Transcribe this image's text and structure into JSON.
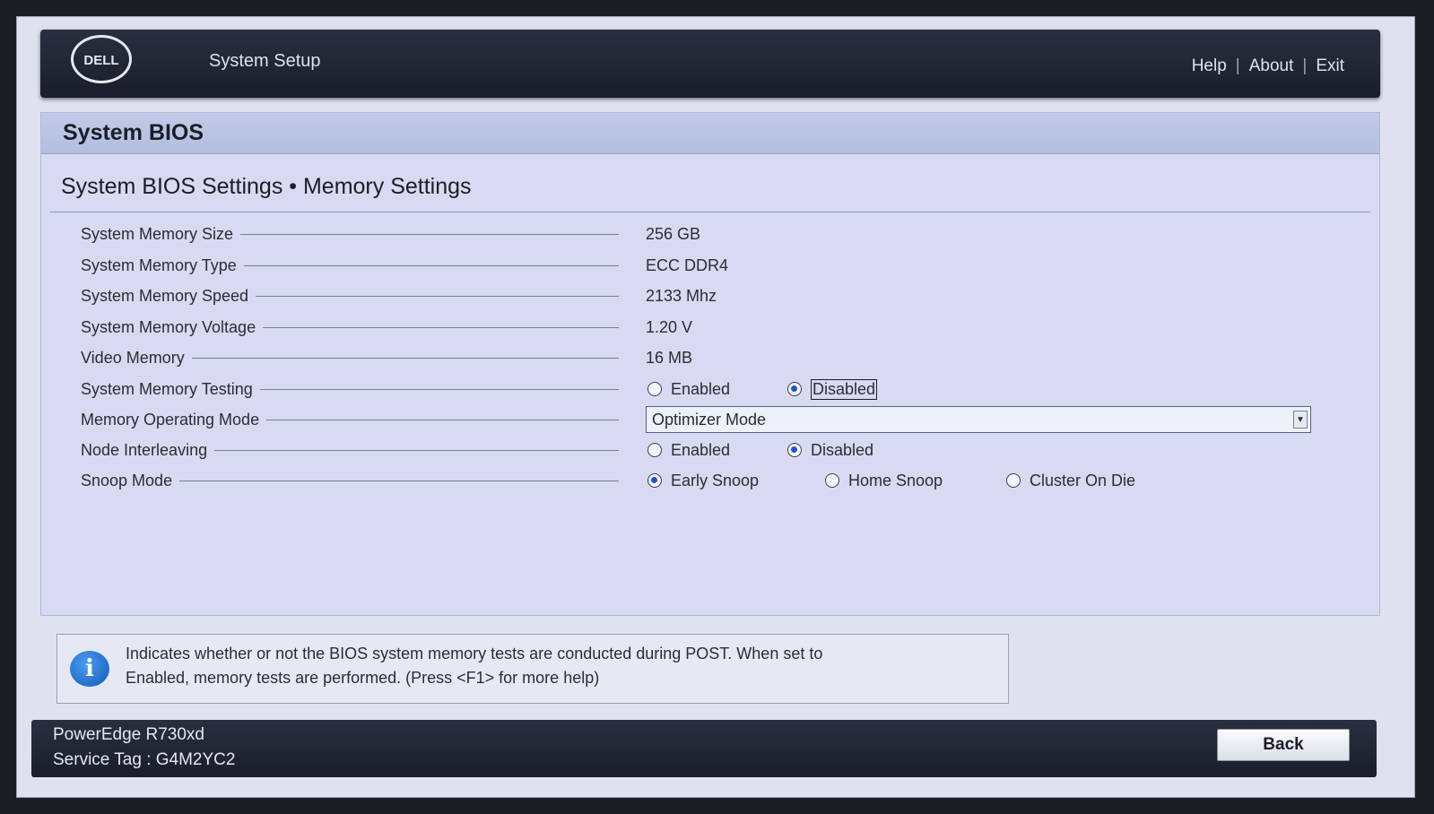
{
  "header": {
    "app_title": "System Setup",
    "nav": {
      "help": "Help",
      "about": "About",
      "exit": "Exit",
      "separator": "|"
    }
  },
  "panel": {
    "title": "System BIOS",
    "subtitle": "System BIOS Settings • Memory Settings",
    "settings": [
      {
        "label": "System Memory Size",
        "value": "256 GB"
      },
      {
        "label": "System Memory Type",
        "value": "ECC DDR4"
      },
      {
        "label": "System Memory Speed",
        "value": "2133 Mhz"
      },
      {
        "label": "System Memory Voltage",
        "value": "1.20 V"
      },
      {
        "label": "Video Memory",
        "value": "16 MB"
      },
      {
        "label": "System Memory Testing",
        "options": [
          "Enabled",
          "Disabled"
        ],
        "selected": "Disabled"
      },
      {
        "label": "Memory Operating Mode",
        "value": "Optimizer Mode"
      },
      {
        "label": "Node Interleaving",
        "options": [
          "Enabled",
          "Disabled"
        ],
        "selected": "Disabled"
      },
      {
        "label": "Snoop Mode",
        "options": [
          "Early Snoop",
          "Home Snoop",
          "Cluster On Die"
        ],
        "selected": "Early Snoop"
      }
    ]
  },
  "info": {
    "icon": "info-icon",
    "text_line1": "Indicates whether or not the BIOS system memory tests are conducted during POST. When set to",
    "text_line2": "Enabled, memory tests are performed. (Press <F1> for more help)"
  },
  "footer": {
    "model": "PowerEdge R730xd",
    "service_tag": "Service Tag : G4M2YC2",
    "back_label": "Back"
  },
  "colors": {
    "header_bg": "#1f2433",
    "panel_bg": "#d7daf0",
    "panel_head_bg": "#bcc4e4",
    "radio_on": "#2650c8",
    "info_icon": "#1a6ad4"
  }
}
